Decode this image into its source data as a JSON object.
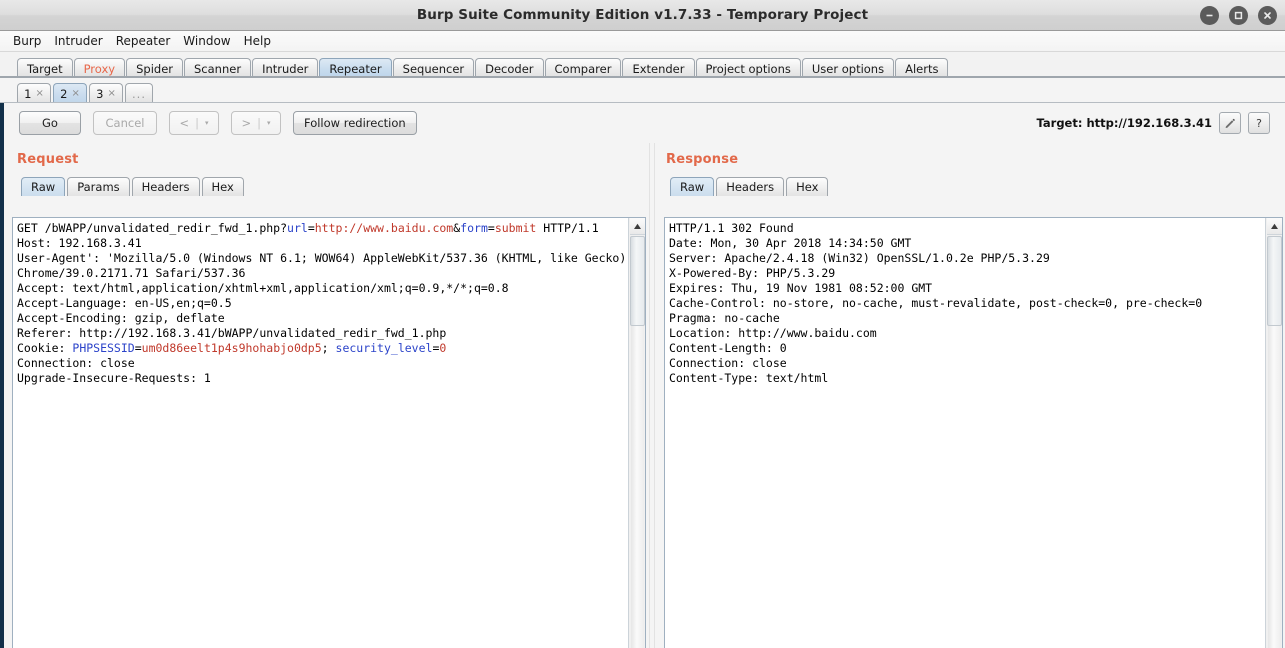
{
  "window": {
    "title": "Burp Suite Community Edition v1.7.33 - Temporary Project",
    "minimize_label": "minimize",
    "maximize_label": "maximize",
    "close_label": "close"
  },
  "menubar": {
    "items": [
      {
        "label": "Burp"
      },
      {
        "label": "Intruder"
      },
      {
        "label": "Repeater"
      },
      {
        "label": "Window"
      },
      {
        "label": "Help"
      }
    ]
  },
  "main_tabs": [
    {
      "label": "Target",
      "selected": false
    },
    {
      "label": "Proxy",
      "selected": false,
      "accent": true
    },
    {
      "label": "Spider",
      "selected": false
    },
    {
      "label": "Scanner",
      "selected": false
    },
    {
      "label": "Intruder",
      "selected": false
    },
    {
      "label": "Repeater",
      "selected": true
    },
    {
      "label": "Sequencer",
      "selected": false
    },
    {
      "label": "Decoder",
      "selected": false
    },
    {
      "label": "Comparer",
      "selected": false
    },
    {
      "label": "Extender",
      "selected": false
    },
    {
      "label": "Project options",
      "selected": false
    },
    {
      "label": "User options",
      "selected": false
    },
    {
      "label": "Alerts",
      "selected": false
    }
  ],
  "repeater_tabs": [
    {
      "label": "1",
      "close": "×",
      "selected": false
    },
    {
      "label": "2",
      "close": "×",
      "selected": true
    },
    {
      "label": "3",
      "close": "×",
      "selected": false
    },
    {
      "label": "...",
      "selected": false
    }
  ],
  "toolbar": {
    "go_label": "Go",
    "cancel_label": "Cancel",
    "back_label": "<",
    "back_caret": "▾",
    "forward_label": ">",
    "forward_caret": "▾",
    "separator": "|",
    "follow_redirection_label": "Follow redirection",
    "target_label": "Target: http://192.168.3.41",
    "edit_icon": "pencil-icon",
    "help_icon": "?"
  },
  "request": {
    "title": "Request",
    "tabs": [
      {
        "label": "Raw",
        "selected": true
      },
      {
        "label": "Params",
        "selected": false
      },
      {
        "label": "Headers",
        "selected": false
      },
      {
        "label": "Hex",
        "selected": false
      }
    ],
    "lines": [
      {
        "segments": [
          {
            "t": "GET /bWAPP/unvalidated_redir_fwd_1.php?",
            "c": "plain"
          },
          {
            "t": "url",
            "c": "k"
          },
          {
            "t": "=",
            "c": "plain"
          },
          {
            "t": "http://www.baidu.com",
            "c": "v"
          },
          {
            "t": "&",
            "c": "plain"
          },
          {
            "t": "form",
            "c": "k"
          },
          {
            "t": "=",
            "c": "plain"
          },
          {
            "t": "submit",
            "c": "v"
          },
          {
            "t": " HTTP/1.1",
            "c": "plain"
          }
        ]
      },
      {
        "segments": [
          {
            "t": "Host: 192.168.3.41",
            "c": "plain"
          }
        ]
      },
      {
        "segments": [
          {
            "t": "User-Agent': 'Mozilla/5.0 (Windows NT 6.1; WOW64) AppleWebKit/537.36 (KHTML, like Gecko) Chrome/39.0.2171.71 Safari/537.36",
            "c": "plain"
          }
        ]
      },
      {
        "segments": [
          {
            "t": "Accept: text/html,application/xhtml+xml,application/xml;q=0.9,*/*;q=0.8",
            "c": "plain"
          }
        ]
      },
      {
        "segments": [
          {
            "t": "Accept-Language: en-US,en;q=0.5",
            "c": "plain"
          }
        ]
      },
      {
        "segments": [
          {
            "t": "Accept-Encoding: gzip, deflate",
            "c": "plain"
          }
        ]
      },
      {
        "segments": [
          {
            "t": "Referer: http://192.168.3.41/bWAPP/unvalidated_redir_fwd_1.php",
            "c": "plain"
          }
        ]
      },
      {
        "segments": [
          {
            "t": "Cookie: ",
            "c": "plain"
          },
          {
            "t": "PHPSESSID",
            "c": "k"
          },
          {
            "t": "=",
            "c": "plain"
          },
          {
            "t": "um0d86eelt1p4s9hohabjo0dp5",
            "c": "v"
          },
          {
            "t": "; ",
            "c": "plain"
          },
          {
            "t": "security_level",
            "c": "k"
          },
          {
            "t": "=",
            "c": "plain"
          },
          {
            "t": "0",
            "c": "v"
          }
        ]
      },
      {
        "segments": [
          {
            "t": "Connection: close",
            "c": "plain"
          }
        ]
      },
      {
        "segments": [
          {
            "t": "Upgrade-Insecure-Requests: 1",
            "c": "plain"
          }
        ]
      }
    ]
  },
  "response": {
    "title": "Response",
    "tabs": [
      {
        "label": "Raw",
        "selected": true
      },
      {
        "label": "Headers",
        "selected": false
      },
      {
        "label": "Hex",
        "selected": false
      }
    ],
    "lines": [
      {
        "segments": [
          {
            "t": "HTTP/1.1 302 Found",
            "c": "plain"
          }
        ]
      },
      {
        "segments": [
          {
            "t": "Date: Mon, 30 Apr 2018 14:34:50 GMT",
            "c": "plain"
          }
        ]
      },
      {
        "segments": [
          {
            "t": "Server: Apache/2.4.18 (Win32) OpenSSL/1.0.2e PHP/5.3.29",
            "c": "plain"
          }
        ]
      },
      {
        "segments": [
          {
            "t": "X-Powered-By: PHP/5.3.29",
            "c": "plain"
          }
        ]
      },
      {
        "segments": [
          {
            "t": "Expires: Thu, 19 Nov 1981 08:52:00 GMT",
            "c": "plain"
          }
        ]
      },
      {
        "segments": [
          {
            "t": "Cache-Control: no-store, no-cache, must-revalidate, post-check=0, pre-check=0",
            "c": "plain"
          }
        ]
      },
      {
        "segments": [
          {
            "t": "Pragma: no-cache",
            "c": "plain"
          }
        ]
      },
      {
        "segments": [
          {
            "t": "Location: http://www.baidu.com",
            "c": "plain"
          }
        ]
      },
      {
        "segments": [
          {
            "t": "Content-Length: 0",
            "c": "plain"
          }
        ]
      },
      {
        "segments": [
          {
            "t": "Connection: close",
            "c": "plain"
          }
        ]
      },
      {
        "segments": [
          {
            "t": "Content-Type: text/html",
            "c": "plain"
          }
        ]
      }
    ]
  },
  "colors": {
    "accent_heading": "#e2694a",
    "proxy_tab": "#e8674a",
    "syntax_key": "#2b43c9",
    "syntax_value": "#c0392b",
    "window_border": "#12304a"
  }
}
